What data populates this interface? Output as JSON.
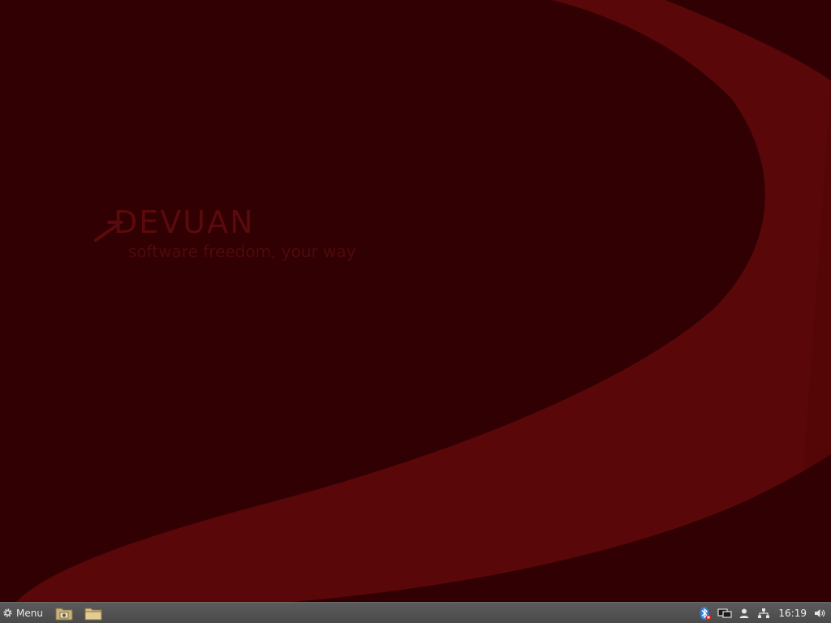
{
  "wallpaper": {
    "logo_text": "DEVUAN",
    "tagline": "software freedom, your way",
    "colors": {
      "background": "#310002",
      "swoosh": "#5a0709",
      "swoosh_edge": "#4a0406"
    }
  },
  "panel": {
    "menu_label": "Menu",
    "launchers": [
      {
        "icon": "image-viewer-folder-icon"
      },
      {
        "icon": "file-manager-folder-icon"
      }
    ],
    "tray": {
      "icons": [
        "bluetooth-disabled-icon",
        "display-switch-icon",
        "user-icon",
        "network-icon",
        "volume-icon"
      ],
      "clock": "16:19"
    }
  }
}
